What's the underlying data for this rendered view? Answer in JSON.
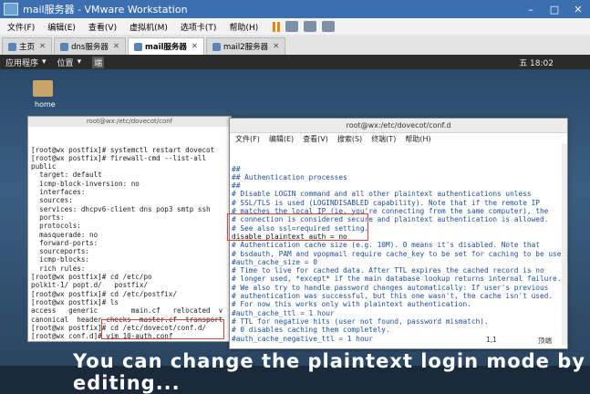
{
  "app": {
    "title": "mail服务器 - VMware Workstation"
  },
  "menu": [
    "文件(F)",
    "编辑(E)",
    "查看(V)",
    "虚拟机(M)",
    "选项卡(T)",
    "帮助(H)"
  ],
  "tabs": [
    {
      "label": "主页"
    },
    {
      "label": "dns服务器"
    },
    {
      "label": "mail服务器"
    },
    {
      "label": "mail2服务器"
    }
  ],
  "gnome": {
    "apps": "应用程序",
    "places": "位置",
    "app3": "端",
    "clock": "五 18:02"
  },
  "desktop": {
    "home_label": "home"
  },
  "termA": {
    "title": "root@wx:/etc/dovecot/conf",
    "lines": [
      "[root@wx postfix]# systemctl restart dovecot",
      "[root@wx postfix]# firewall-cmd --list-all",
      "public",
      "  target: default",
      "  icmp-block-inversion: no",
      "  interfaces:",
      "  sources:",
      "  services: dhcpv6-client dns pop3 smtp ssh",
      "  ports:",
      "  protocols:",
      "  masquerade: no",
      "  forward-ports:",
      "  sourceports:",
      "  icmp-blocks:",
      "  rich rules:",
      "",
      "[root@wx postfix]# cd /etc/po",
      "polkit-1/ popt.d/   postfix/",
      "[root@wx postfix]# cd /etc/postfix/",
      "[root@wx postfix]# ls",
      "access   generic        main.cf   relocated  v",
      "canonical  header_checks  master.cf  transport",
      "[root@wx postfix]# cd /etc/dovecot/conf.d/",
      "[root@wx conf.d]# vim 10-auth.conf"
    ]
  },
  "termB": {
    "title": "root@wx:/etc/dovecot/conf.d",
    "menu": [
      "文件(F)",
      "编辑(E)",
      "查看(V)",
      "搜索(S)",
      "终端(T)",
      "帮助(H)"
    ],
    "lines": [
      "##",
      "## Authentication processes",
      "##",
      "",
      "# Disable LOGIN command and all other plaintext authentications unless",
      "# SSL/TLS is used (LOGINDISABLED capability). Note that if the remote IP",
      "# matches the local IP (ie. you're connecting from the same computer), the",
      "# connection is considered secure and plaintext authentication is allowed.",
      "# See also ssl=required setting.",
      "disable_plaintext_auth = no",
      "",
      "# Authentication cache size (e.g. 10M). 0 means it's disabled. Note that",
      "# bsdauth, PAM and vpopmail require cache_key to be set for caching to be used.",
      "#auth_cache_size = 0",
      "# Time to live for cached data. After TTL expires the cached record is no",
      "# longer used, *except* if the main database lookup returns internal failure.",
      "# We also try to handle password changes automatically: If user's previous",
      "# authentication was successful, but this one wasn't, the cache isn't used.",
      "# For now this works only with plaintext authentication.",
      "#auth_cache_ttl = 1 hour",
      "# TTL for negative hits (user not found, password mismatch).",
      "# 0 disables caching them completely.",
      "#auth_cache_negative_ttl = 1 hour"
    ],
    "pos": "1,1",
    "scroll_label": "顶端"
  },
  "subtitle": "You can change the plaintext login mode by editing..."
}
